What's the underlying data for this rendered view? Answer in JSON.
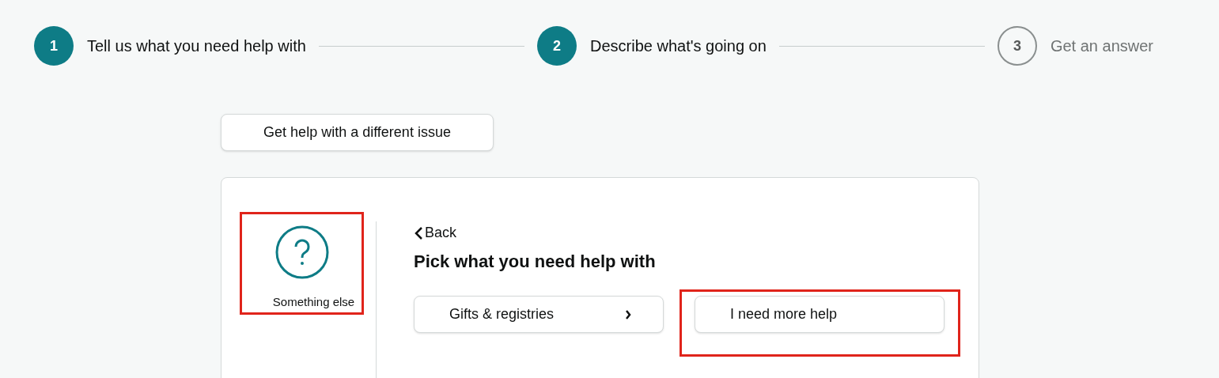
{
  "steps": [
    {
      "number": "1",
      "label": "Tell us what you need help with",
      "reached": true
    },
    {
      "number": "2",
      "label": "Describe what's going on",
      "reached": true
    },
    {
      "number": "3",
      "label": "Get an answer",
      "reached": false
    }
  ],
  "different_issue_button": "Get help with a different issue",
  "topic": {
    "label": "Something else",
    "highlighted": true
  },
  "back_link": "Back",
  "heading": "Pick what you need help with",
  "options": [
    {
      "label": "Gifts & registries",
      "kind": "chevron",
      "highlighted": false
    },
    {
      "label": "I need more help",
      "kind": "plain",
      "highlighted": true
    }
  ]
}
